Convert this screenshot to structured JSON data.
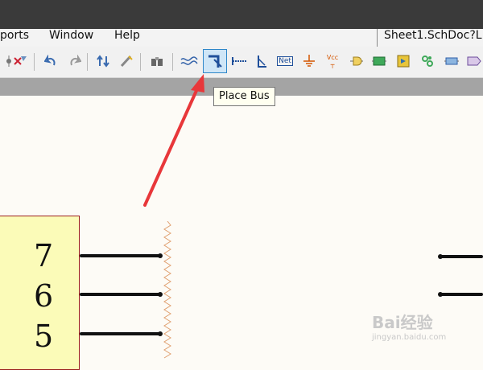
{
  "menu": {
    "items": [
      "ports",
      "Window",
      "Help"
    ],
    "document_title": "Sheet1.SchDoc?L"
  },
  "toolbar": {
    "buttons": [
      {
        "name": "pin-icon"
      },
      {
        "name": "clear-filter-icon"
      },
      {
        "name": "undo-icon"
      },
      {
        "name": "redo-icon"
      },
      {
        "name": "cross-probe-icon"
      },
      {
        "name": "highlight-icon"
      },
      {
        "name": "binoculars-icon"
      },
      {
        "name": "place-wire-icon"
      },
      {
        "name": "place-bus-icon"
      },
      {
        "name": "bus-entry-icon"
      },
      {
        "name": "signal-harness-icon"
      },
      {
        "name": "net-label-icon",
        "label": "Net"
      },
      {
        "name": "gnd-port-icon"
      },
      {
        "name": "vcc-port-icon",
        "label": "Vcc"
      },
      {
        "name": "place-part-icon"
      },
      {
        "name": "sheet-symbol-icon"
      },
      {
        "name": "sheet-entry-icon"
      },
      {
        "name": "device-sheet-icon"
      },
      {
        "name": "port-icon"
      },
      {
        "name": "off-sheet-icon"
      }
    ]
  },
  "tooltip": "Place Bus",
  "component": {
    "pins": [
      "7",
      "6",
      "5"
    ]
  },
  "watermark": {
    "text": "Bai经验",
    "sub": "jingyan.baidu.com"
  },
  "colors": {
    "arrow": "#e8373a",
    "component_fill": "#fbfbb8",
    "component_border": "#9b1e1e",
    "active_button": "#cfe6f7"
  }
}
